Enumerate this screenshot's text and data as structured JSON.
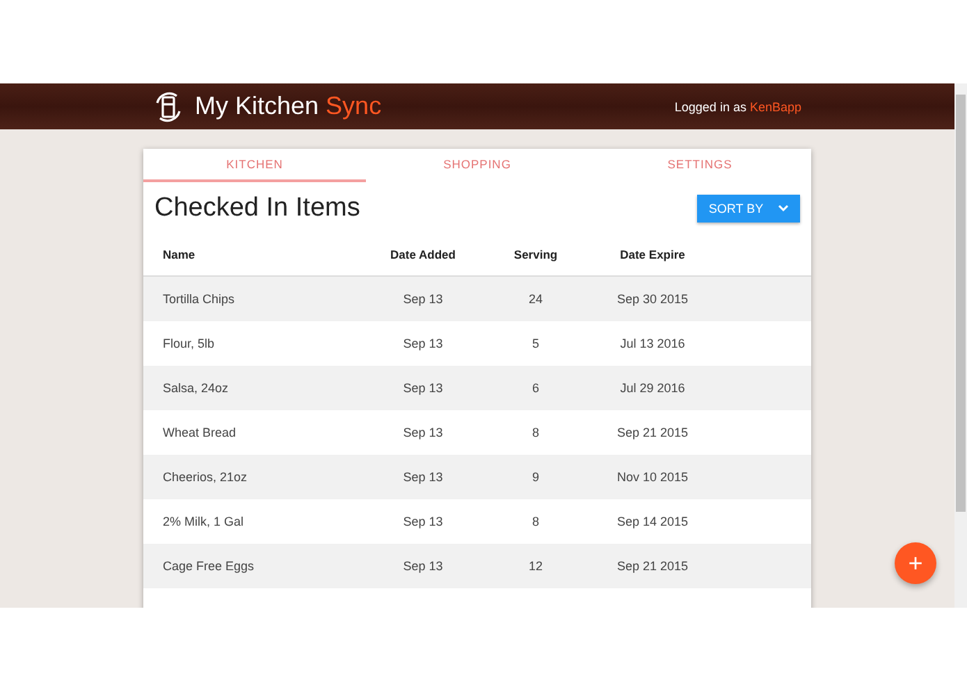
{
  "header": {
    "brand": "My Kitchen",
    "brand_accent": "Sync",
    "login_label": "Logged in as",
    "username": "KenBapp"
  },
  "tabs": [
    {
      "label": "KITCHEN",
      "selected": true
    },
    {
      "label": "SHOPPING",
      "selected": false
    },
    {
      "label": "SETTINGS",
      "selected": false
    }
  ],
  "title": "Checked In Items",
  "sort_button": "SORT BY",
  "table": {
    "columns": [
      "Name",
      "Date Added",
      "Serving",
      "Date Expire"
    ],
    "rows": [
      [
        "Tortilla Chips",
        "Sep 13",
        "24",
        "Sep 30 2015"
      ],
      [
        "Flour, 5lb",
        "Sep 13",
        "5",
        "Jul 13 2016"
      ],
      [
        "Salsa, 24oz",
        "Sep 13",
        "6",
        "Jul 29 2016"
      ],
      [
        "Wheat Bread",
        "Sep 13",
        "8",
        "Sep 21 2015"
      ],
      [
        "Cheerios, 21oz",
        "Sep 13",
        "9",
        "Nov 10 2015"
      ],
      [
        "2% Milk, 1 Gal",
        "Sep 13",
        "8",
        "Sep 14 2015"
      ],
      [
        "Cage Free Eggs",
        "Sep 13",
        "12",
        "Sep 21 2015"
      ]
    ]
  },
  "fab": "+"
}
